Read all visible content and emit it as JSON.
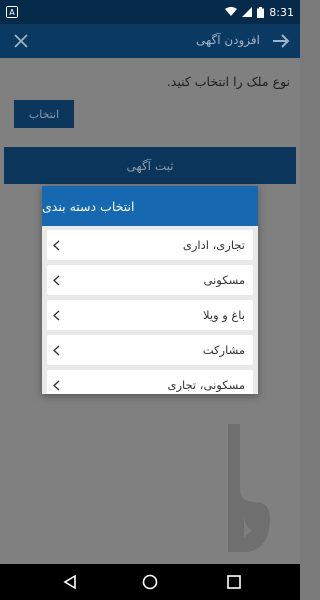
{
  "status_bar": {
    "left_badge": "A",
    "time": "8:31",
    "icons": [
      "wifi-icon",
      "signal-icon",
      "battery-icon"
    ]
  },
  "app_bar": {
    "title": "افزودن آگهی",
    "back_icon": "arrow-right-icon",
    "close_icon": "close-icon"
  },
  "form": {
    "prompt": "نوع ملک را انتخاب کنید.",
    "select_label": "انتخاب",
    "submit_label": "ثبت آگهی"
  },
  "dialog": {
    "title": "انتخاب دسته بندی",
    "items": [
      {
        "label": "تجاری، اداری"
      },
      {
        "label": "مسکونی"
      },
      {
        "label": "باغ و ویلا"
      },
      {
        "label": "مشارکت"
      },
      {
        "label": "مسکونی، تجاری"
      }
    ]
  },
  "nav_bar": {
    "icons": [
      "back-triangle-icon",
      "home-circle-icon",
      "recents-square-icon"
    ]
  },
  "colors": {
    "status_bar": "#062a4a",
    "app_bar": "#0a3962",
    "dialog_header": "#1669b1",
    "button": "#0b355a"
  }
}
